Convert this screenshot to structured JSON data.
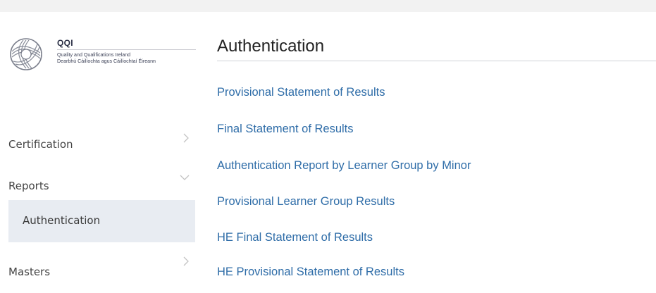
{
  "logo": {
    "title": "QQI",
    "subtitle_line1": "Quality and Qualifications Ireland",
    "subtitle_line2": "Dearbhú Cáilíochta agus Cáilíochtaí Éireann",
    "icon": "qqi-knot-icon"
  },
  "sidebar": {
    "items": [
      {
        "label": "Certification",
        "icon": "chevron-right-icon"
      },
      {
        "label": "Reports",
        "icon": "chevron-down-icon"
      },
      {
        "label": "Authentication",
        "selected": true
      },
      {
        "label": "Masters",
        "icon": "chevron-right-icon"
      }
    ]
  },
  "main": {
    "title": "Authentication",
    "links": [
      "Provisional Statement of Results",
      "Final Statement of Results",
      "Authentication Report by Learner Group by Minor",
      "Provisional Learner Group Results",
      "HE Final Statement of Results",
      "HE Provisional Statement of Results"
    ]
  },
  "colors": {
    "link": "#2f6da8",
    "selected_bg": "#e8ecf2",
    "top_bar": "#f2f2f2"
  }
}
